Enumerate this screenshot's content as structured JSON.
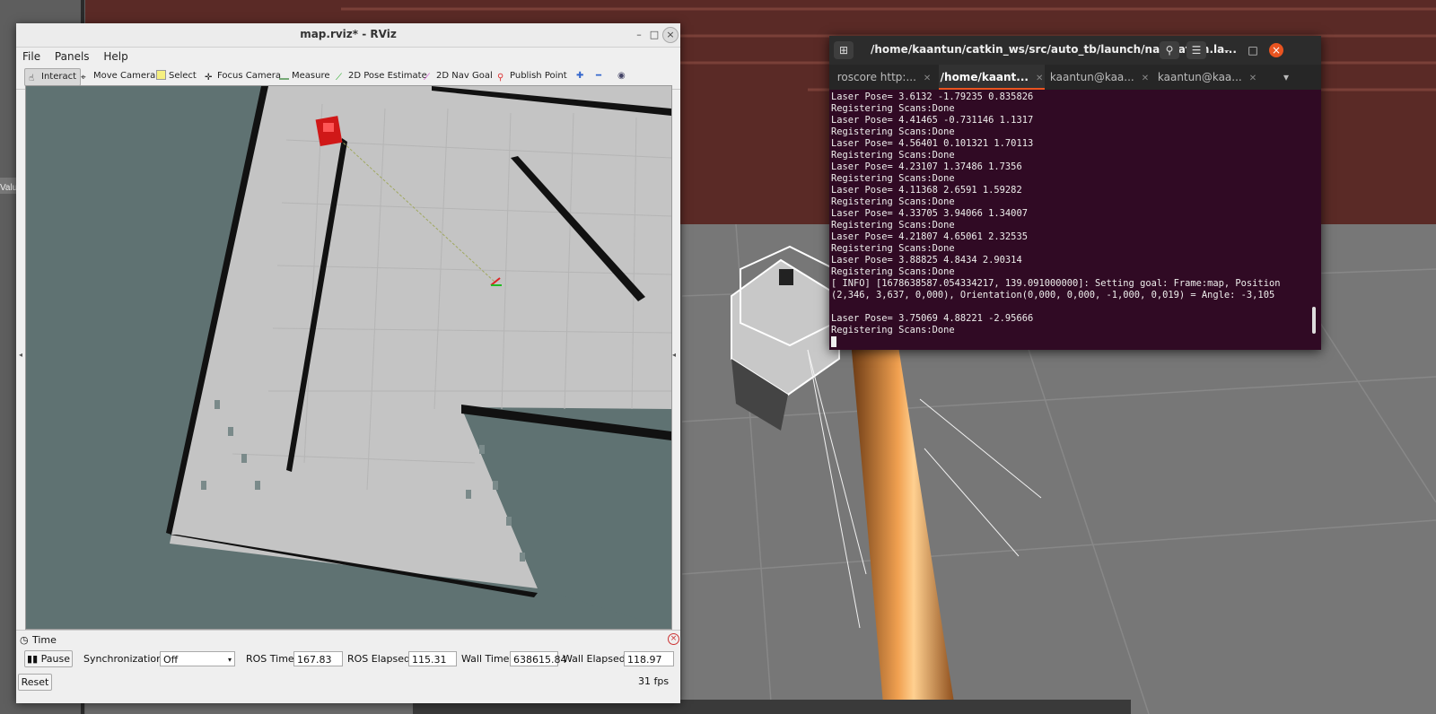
{
  "rviz": {
    "title": "map.rviz* - RViz",
    "menu": [
      "File",
      "Panels",
      "Help"
    ],
    "tools": [
      "Interact",
      "Move Camera",
      "Select",
      "Focus Camera",
      "Measure",
      "2D Pose Estimate",
      "2D Nav Goal",
      "Publish Point"
    ],
    "time_panel": {
      "title": "Time",
      "pause_label": "Pause",
      "sync_label": "Synchronization:",
      "sync_value": "Off",
      "ros_time_label": "ROS Time:",
      "ros_time": "167.83",
      "ros_elapsed_label": "ROS Elapsed:",
      "ros_elapsed": "115.31",
      "wall_time_label": "Wall Time:",
      "wall_time": "638615.84",
      "wall_elapsed_label": "Wall Elapsed:",
      "wall_elapsed": "118.97",
      "reset_label": "Reset",
      "fps": "31 fps"
    }
  },
  "gazebo": {
    "side_label": "Valu"
  },
  "terminal": {
    "path": "/home/kaantun/catkin_ws/src/auto_tb/launch/navigation.la...",
    "tabs": [
      "roscore http:...",
      "/home/kaant...",
      "kaantun@kaa...",
      "kaantun@kaa..."
    ],
    "lines": [
      "Laser Pose= 3.6132 -1.79235 0.835826",
      "Registering Scans:Done",
      "Laser Pose= 4.41465 -0.731146 1.1317",
      "Registering Scans:Done",
      "Laser Pose= 4.56401 0.101321 1.70113",
      "Registering Scans:Done",
      "Laser Pose= 4.23107 1.37486 1.7356",
      "Registering Scans:Done",
      "Laser Pose= 4.11368 2.6591 1.59282",
      "Registering Scans:Done",
      "Laser Pose= 4.33705 3.94066 1.34007",
      "Registering Scans:Done",
      "Laser Pose= 4.21807 4.65061 2.32535",
      "Registering Scans:Done",
      "Laser Pose= 3.88825 4.8434 2.90314",
      "Registering Scans:Done",
      "[ INFO] [1678638587.054334217, 139.091000000]: Setting goal: Frame:map, Position",
      "(2,346, 3,637, 0,000), Orientation(0,000, 0,000, -1,000, 0,019) = Angle: -3,105",
      "",
      "Laser Pose= 3.75069 4.88221 -2.95666",
      "Registering Scans:Done"
    ]
  }
}
